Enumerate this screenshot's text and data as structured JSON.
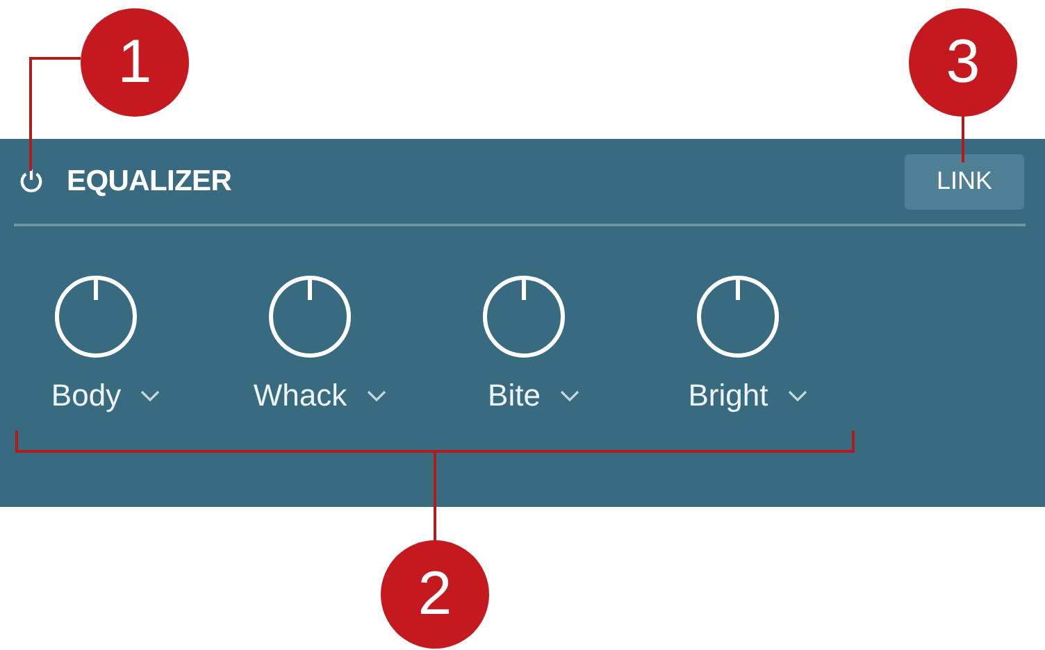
{
  "panel": {
    "title": "EQUALIZER",
    "link_button": "LINK",
    "knobs": [
      {
        "label": "Body"
      },
      {
        "label": "Whack"
      },
      {
        "label": "Bite"
      },
      {
        "label": "Bright"
      }
    ]
  },
  "callouts": [
    {
      "number": "1"
    },
    {
      "number": "2"
    },
    {
      "number": "3"
    }
  ]
}
